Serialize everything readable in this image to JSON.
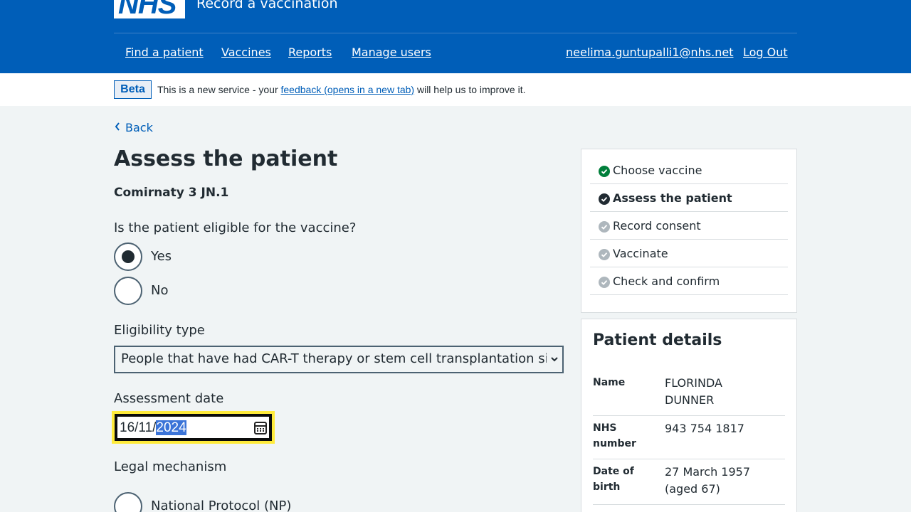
{
  "header": {
    "logo_text": "NHS",
    "service_name": "Record a vaccination",
    "nav": [
      "Find a patient",
      "Vaccines",
      "Reports",
      "Manage users"
    ],
    "user_email": "neelima.guntupalli1@nhs.net",
    "logout_label": "Log Out"
  },
  "beta": {
    "tag": "Beta",
    "text_before": "This is a new service - your",
    "link": "feedback (opens in a new tab)",
    "text_after": "will help us to improve it."
  },
  "back_label": "Back",
  "page_title": "Assess the patient",
  "vaccine_name": "Comirnaty 3 JN.1",
  "eligible": {
    "question": "Is the patient eligible for the vaccine?",
    "options": [
      "Yes",
      "No"
    ],
    "selected": "Yes"
  },
  "eligibility_type": {
    "label": "Eligibility type",
    "value": "People that have had CAR-T therapy or stem cell transplantation since their last vaccine"
  },
  "assessment_date": {
    "label": "Assessment date",
    "value_prefix": "16/11/",
    "value_selected": "2024"
  },
  "legal_mechanism": {
    "label": "Legal mechanism",
    "options": [
      "National Protocol (NP)"
    ]
  },
  "steps": [
    {
      "label": "Choose vaccine",
      "status": "complete"
    },
    {
      "label": "Assess the patient",
      "status": "current"
    },
    {
      "label": "Record consent",
      "status": "pending"
    },
    {
      "label": "Vaccinate",
      "status": "pending"
    },
    {
      "label": "Check and confirm",
      "status": "pending"
    }
  ],
  "patient": {
    "title": "Patient details",
    "name_label": "Name",
    "name_value": "FLORINDA DUNNER",
    "nhs_label": "NHS number",
    "nhs_value": "943 754 1817",
    "dob_label": "Date of birth",
    "dob_value": "27 March 1957 (aged 67)"
  },
  "colors": {
    "nhs_blue": "#005eb8",
    "complete_green": "#007f3b",
    "pending_grey": "#aeb7bd",
    "focus_yellow": "#ffeb3b"
  }
}
